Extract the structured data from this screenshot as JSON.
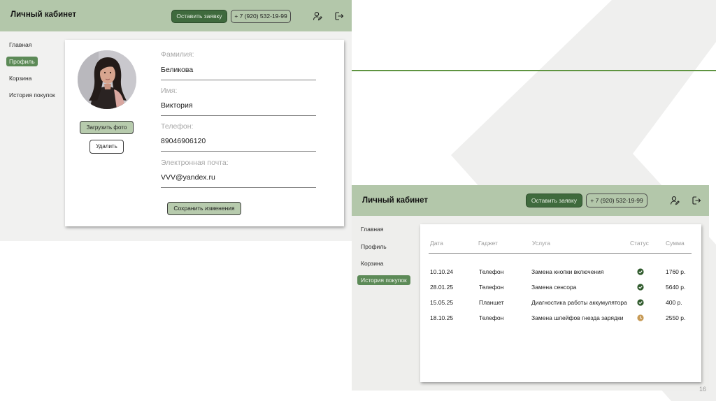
{
  "profile_screen": {
    "header": {
      "title": "Личный кабинет",
      "request_button": "Оставить заявку",
      "phone_button": "+ 7 (920) 532-19-99",
      "user_icon": "user-edit-icon",
      "exit_icon": "logout-icon"
    },
    "sidebar": {
      "items": [
        {
          "label": "Главная",
          "active": false
        },
        {
          "label": "Профиль",
          "active": true
        },
        {
          "label": "Корзина",
          "active": false
        },
        {
          "label": "История покупок",
          "active": false
        }
      ]
    },
    "card": {
      "upload_button": "Загрузить фото",
      "delete_button": "Удалить",
      "fields": [
        {
          "label": "Фамилия:",
          "value": "Беликова"
        },
        {
          "label": "Имя:",
          "value": "Виктория"
        },
        {
          "label": "Телефон:",
          "value": "89046906120"
        },
        {
          "label": "Электронная почта:",
          "value": "VVV@yandex.ru"
        }
      ],
      "save_button": "Сохранить изменения"
    }
  },
  "history_screen": {
    "header": {
      "title": "Личный кабинет",
      "request_button": "Оставить заявку",
      "phone_button": "+ 7 (920) 532-19-99",
      "user_icon": "user-edit-icon",
      "exit_icon": "logout-icon"
    },
    "sidebar": {
      "items": [
        {
          "label": "Главная",
          "active": false
        },
        {
          "label": "Профиль",
          "active": false
        },
        {
          "label": "Корзина",
          "active": false
        },
        {
          "label": "История покупок",
          "active": true
        }
      ]
    },
    "table": {
      "headers": {
        "date": "Дата",
        "gadget": "Гаджет",
        "service": "Услуга",
        "status": "Статус",
        "sum": "Сумма"
      },
      "rows": [
        {
          "date": "10.10.24",
          "gadget": "Телефон",
          "service": "Замена кнопки включения",
          "status": "done",
          "sum": "1760 р."
        },
        {
          "date": "28.01.25",
          "gadget": "Телефон",
          "service": "Замена сенсора",
          "status": "done",
          "sum": "5640 р."
        },
        {
          "date": "15.05.25",
          "gadget": "Планшет",
          "service": "Диагностика работы аккумулятора",
          "status": "done",
          "sum": "400 р."
        },
        {
          "date": "18.10.25",
          "gadget": "Телефон",
          "service": "Замена шлейфов гнезда зарядки",
          "status": "pending",
          "sum": "2550 р."
        }
      ]
    }
  },
  "colors": {
    "header_green": "#b3c7aa",
    "dark_green": "#3f6a3d",
    "active_green": "#5c8a57",
    "status_done": "#2f5a2c",
    "status_pending": "#c79a55",
    "accent_line": "#5f9441"
  },
  "page_number": "16"
}
